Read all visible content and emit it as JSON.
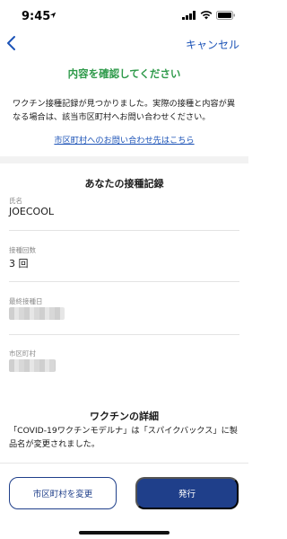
{
  "status_bar": {
    "time": "9:45",
    "location_icon": "location-arrow-icon"
  },
  "nav": {
    "back_icon": "chevron-left-icon",
    "cancel_label": "キャンセル"
  },
  "header": {
    "title": "内容を確認してください",
    "intro": "ワクチン接種記録が見つかりました。実際の接種と内容が異なる場合は、該当市区町村へお問い合わせください。",
    "contact_link": "市区町村へのお問い合わせ先はこちら"
  },
  "record": {
    "section_title": "あなたの接種記録",
    "fields": [
      {
        "label": "氏名",
        "value": "JOECOOL"
      },
      {
        "label": "接種回数",
        "value": "3 回"
      },
      {
        "label": "最終接種日",
        "value": ""
      },
      {
        "label": "市区町村",
        "value": ""
      }
    ]
  },
  "vaccine": {
    "section_title": "ワクチンの詳細",
    "description": "「COVID-19ワクチンモデルナ」は「スパイクバックス」に製品名が変更されました。"
  },
  "actions": {
    "change_municipality_label": "市区町村を変更",
    "issue_label": "発行"
  },
  "colors": {
    "accent_blue": "#1c53b7",
    "button_navy": "#1f3f8a",
    "title_green": "#2e9a4a"
  }
}
